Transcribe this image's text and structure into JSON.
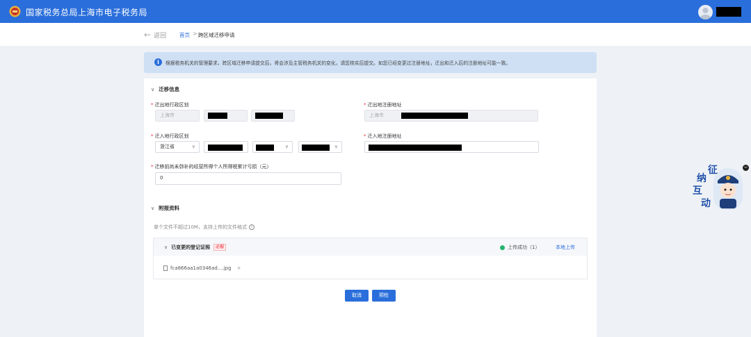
{
  "header": {
    "title": "国家税务总局上海市电子税务局"
  },
  "nav": {
    "back_label": "返回",
    "breadcrumb_home": "首页",
    "breadcrumb_separator": ">",
    "breadcrumb_current": "跨区域迁移申请"
  },
  "notice": {
    "text": "根据税务机关的管理要求，跨区域迁移申请提交后，将会涉及主管税务机关的变化，请您核实后提交。如您已经变更过注册地址，迁出和迁入后的注册地址可能一致。"
  },
  "migration": {
    "section_title": "迁移信息",
    "out_region_label": "迁出地行政区划",
    "out_region_value": "上海市",
    "out_address_label": "迁出地注册地址",
    "out_address_value": "上海市",
    "in_region_label": "迁入地行政区划",
    "in_province_value": "浙江省",
    "in_address_label": "迁入地注册地址",
    "loss_label": "迁移前尚未弥补的经营所得个人所得税累计亏损（元）",
    "loss_value": "0"
  },
  "attachments": {
    "section_title": "附报资料",
    "hint": "单个文件不超过10M，支持上传的文件格式",
    "item_title": "已变更的登记证照",
    "required_badge": "必报",
    "status": "上传成功（1）",
    "upload_link": "本地上传",
    "file_name": "fca866aa1a0346ad....jpg",
    "remove": "×"
  },
  "actions": {
    "cancel": "取消",
    "precheck": "预检"
  },
  "mascot": {
    "chars": [
      "征",
      "纳",
      "互",
      "动"
    ],
    "close": "−"
  },
  "colors": {
    "primary": "#2a6edb",
    "notice_bg": "#cfe0f5",
    "required": "#e23333",
    "success": "#28b36c"
  }
}
